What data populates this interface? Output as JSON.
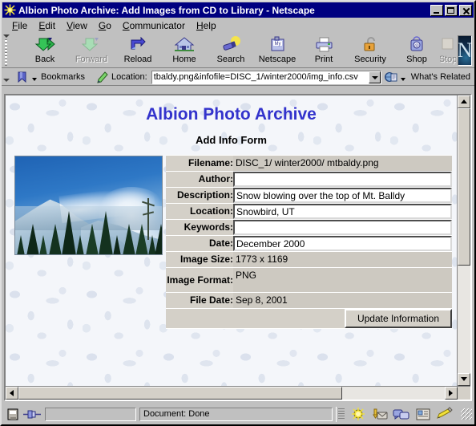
{
  "window": {
    "title": "Albion Photo Archive: Add Images from CD to Library - Netscape",
    "app_icon": "netscape-starburst-icon",
    "buttons": {
      "minimize": "minimize-button",
      "maximize": "maximize-button",
      "close": "close-button"
    }
  },
  "menubar": {
    "items": [
      {
        "label": "File"
      },
      {
        "label": "Edit"
      },
      {
        "label": "View"
      },
      {
        "label": "Go"
      },
      {
        "label": "Communicator"
      },
      {
        "label": "Help"
      }
    ]
  },
  "toolbar": {
    "buttons": [
      {
        "label": "Back",
        "icon": "back-arrow-icon",
        "disabled": false
      },
      {
        "label": "Forward",
        "icon": "forward-arrow-icon",
        "disabled": true
      },
      {
        "label": "Reload",
        "icon": "reload-icon",
        "disabled": false
      },
      {
        "label": "Home",
        "icon": "home-icon",
        "disabled": false
      },
      {
        "label": "Search",
        "icon": "search-flashlight-icon",
        "disabled": false
      },
      {
        "label": "Netscape",
        "icon": "my-netscape-icon",
        "disabled": false
      },
      {
        "label": "Print",
        "icon": "printer-icon",
        "disabled": false
      },
      {
        "label": "Security",
        "icon": "padlock-icon",
        "disabled": false
      },
      {
        "label": "Shop",
        "icon": "shopping-bag-icon",
        "disabled": false
      },
      {
        "label": "Stop",
        "icon": "stop-icon",
        "disabled": true
      }
    ],
    "logo": "N"
  },
  "locationbar": {
    "bookmarks_label": "Bookmarks",
    "bookmarks_icon": "bookmark-icon",
    "location_label": "Location:",
    "location_icon": "compass-pen-icon",
    "url": "tbaldy.png&infofile=DISC_1/winter2000/img_info.csv",
    "url_placeholder": "Enter location",
    "dropdown_icon": "chevron-down-icon",
    "whats_related_label": "What's Related",
    "whats_related_icon": "whats-related-icon"
  },
  "page": {
    "heading": "Albion Photo Archive",
    "subheading": "Add Info Form",
    "heading_color": "#3333cc",
    "photo_alt": "snowy-mountain-photo",
    "form": {
      "rows": [
        {
          "label": "Filename:",
          "value": "DISC_1/ winter2000/ mtbaldy.png",
          "type": "readonly",
          "name": "filename"
        },
        {
          "label": "Author:",
          "value": "",
          "type": "input",
          "name": "author"
        },
        {
          "label": "Description:",
          "value": "Snow blowing over the top of Mt. Balldy",
          "type": "input",
          "name": "description"
        },
        {
          "label": "Location:",
          "value": "Snowbird, UT",
          "type": "input",
          "name": "location"
        },
        {
          "label": "Keywords:",
          "value": "",
          "type": "input",
          "name": "keywords"
        },
        {
          "label": "Date:",
          "value": "December 2000",
          "type": "input",
          "name": "date"
        },
        {
          "label": "Image Size:",
          "value": "1773 x 1169",
          "type": "readonly",
          "name": "image-size"
        },
        {
          "label": "Image Format:",
          "value": "PNG",
          "type": "readonly",
          "name": "image-format"
        },
        {
          "label": "File Date:",
          "value": "Sep 8, 2001",
          "type": "readonly",
          "name": "file-date"
        }
      ],
      "submit_label": "Update Information"
    }
  },
  "statusbar": {
    "security_icon": "security-padlock-icon",
    "connection_icon": "connection-plug-icon",
    "message": "Document: Done",
    "component_icons": [
      "navigator-icon",
      "mailbox-icon",
      "newsgroups-icon",
      "address-book-icon",
      "composer-icon"
    ]
  }
}
